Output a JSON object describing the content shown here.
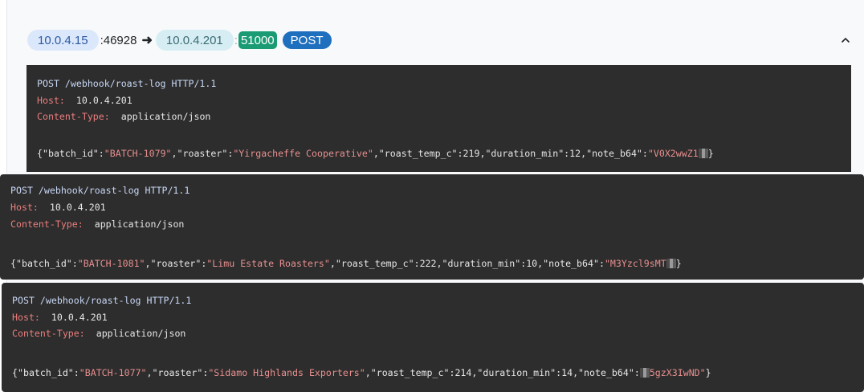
{
  "flow": {
    "src_ip": "10.0.4.15",
    "src_port": ":46928",
    "arrow": "➜",
    "dst_ip": "10.0.4.201",
    "dst_sep": ":",
    "dst_port": "51000",
    "method": "POST"
  },
  "blocks": [
    {
      "request_line": "POST /webhook/roast-log HTTP/1.1",
      "host_key": "Host:",
      "host_val": "10.0.4.201",
      "ct_key": "Content-Type:",
      "ct_val": "application/json",
      "batch_id": "\"BATCH-1079\"",
      "roaster": "\"Yirgacheffe Cooperative\"",
      "roast_temp_c": "219",
      "duration_min": "12",
      "note_b64": "\"V0X2wwZ1"
    },
    {
      "request_line": "POST /webhook/roast-log HTTP/1.1",
      "host_key": "Host:",
      "host_val": "10.0.4.201",
      "ct_key": "Content-Type:",
      "ct_val": "application/json",
      "batch_id": "\"BATCH-1081\"",
      "roaster": "\"Limu Estate Roasters\"",
      "roast_temp_c": "222",
      "duration_min": "10",
      "note_b64": "\"M3Yzcl9sMT"
    },
    {
      "request_line": "POST /webhook/roast-log HTTP/1.1",
      "host_key": "Host:",
      "host_val": "10.0.4.201",
      "ct_key": "Content-Type:",
      "ct_val": "application/json",
      "batch_id": "\"BATCH-1077\"",
      "roaster": "\"Sidamo Highlands Exporters\"",
      "roast_temp_c": "214",
      "duration_min": "14",
      "note_b64_tail": "5gzX3IwND\""
    }
  ],
  "json_keys": {
    "open": "{",
    "batch_id": "\"batch_id\":",
    "roaster": ",\"roaster\":",
    "roast_temp_c": ",\"roast_temp_c\":",
    "duration_min": ",\"duration_min\":",
    "note_b64": ",\"note_b64\":",
    "close": "}"
  },
  "icons": {
    "collapse": "chevron-up-icon",
    "redaction": "pixelated-redaction"
  },
  "colors": {
    "src_pill": "#dbe7fb",
    "dst_pill": "#d6eef3",
    "port_badge": "#1a9b74",
    "method_badge": "#1f6fbf",
    "code_bg": "#2d2d2d"
  }
}
